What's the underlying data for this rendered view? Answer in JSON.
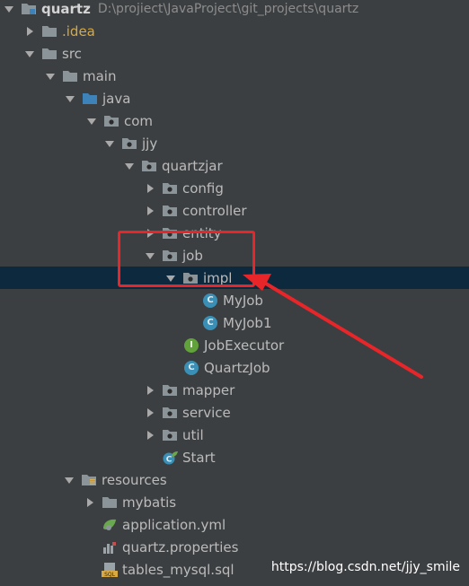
{
  "tree": [
    {
      "label": "quartz",
      "path": "D:\\projiect\\JavaProject\\git_projects\\quartz",
      "icon": "module-folder-icon",
      "state": "expanded",
      "bold": true
    },
    {
      "label": ".idea",
      "icon": "folder-icon",
      "state": "collapsed",
      "excluded": true
    },
    {
      "label": "src",
      "icon": "folder-icon",
      "state": "expanded"
    },
    {
      "label": "main",
      "icon": "folder-icon",
      "state": "expanded"
    },
    {
      "label": "java",
      "icon": "source-folder-icon",
      "state": "expanded"
    },
    {
      "label": "com",
      "icon": "package-icon",
      "state": "expanded"
    },
    {
      "label": "jjy",
      "icon": "package-icon",
      "state": "expanded"
    },
    {
      "label": "quartzjar",
      "icon": "package-icon",
      "state": "expanded"
    },
    {
      "label": "config",
      "icon": "package-icon",
      "state": "collapsed"
    },
    {
      "label": "controller",
      "icon": "package-icon",
      "state": "collapsed"
    },
    {
      "label": "entity",
      "icon": "package-icon",
      "state": "collapsed"
    },
    {
      "label": "job",
      "icon": "package-icon",
      "state": "expanded"
    },
    {
      "label": "impl",
      "icon": "package-icon",
      "state": "expanded",
      "selected": true
    },
    {
      "label": "MyJob",
      "icon": "class-icon",
      "state": "leaf"
    },
    {
      "label": "MyJob1",
      "icon": "class-icon",
      "state": "leaf"
    },
    {
      "label": "JobExecutor",
      "icon": "interface-icon",
      "state": "leaf"
    },
    {
      "label": "QuartzJob",
      "icon": "class-icon",
      "state": "leaf"
    },
    {
      "label": "mapper",
      "icon": "package-icon",
      "state": "collapsed"
    },
    {
      "label": "service",
      "icon": "package-icon",
      "state": "collapsed"
    },
    {
      "label": "util",
      "icon": "package-icon",
      "state": "collapsed"
    },
    {
      "label": "Start",
      "icon": "spring-boot-class-icon",
      "state": "leaf"
    },
    {
      "label": "resources",
      "icon": "resources-folder-icon",
      "state": "expanded"
    },
    {
      "label": "mybatis",
      "icon": "folder-icon",
      "state": "collapsed"
    },
    {
      "label": "application.yml",
      "icon": "yaml-file-icon",
      "state": "leaf"
    },
    {
      "label": "quartz.properties",
      "icon": "properties-file-icon",
      "state": "leaf"
    },
    {
      "label": "tables_mysql.sql",
      "icon": "sql-file-icon",
      "state": "leaf"
    }
  ],
  "annotation": {
    "highlight_color": "#e8262a",
    "highlighted_nodes": [
      "job",
      "impl"
    ]
  },
  "watermark": "https://blog.csdn.net/jjy_smile",
  "colors": {
    "background": "#3c3f41",
    "selected_row": "#0d293e",
    "text": "#bbbbbb",
    "excluded_text": "#d8a942",
    "folder_grey": "#8a9499",
    "source_blue": "#3d82b8",
    "class_blue": "#3a8fb6",
    "interface_green": "#62a23a"
  }
}
